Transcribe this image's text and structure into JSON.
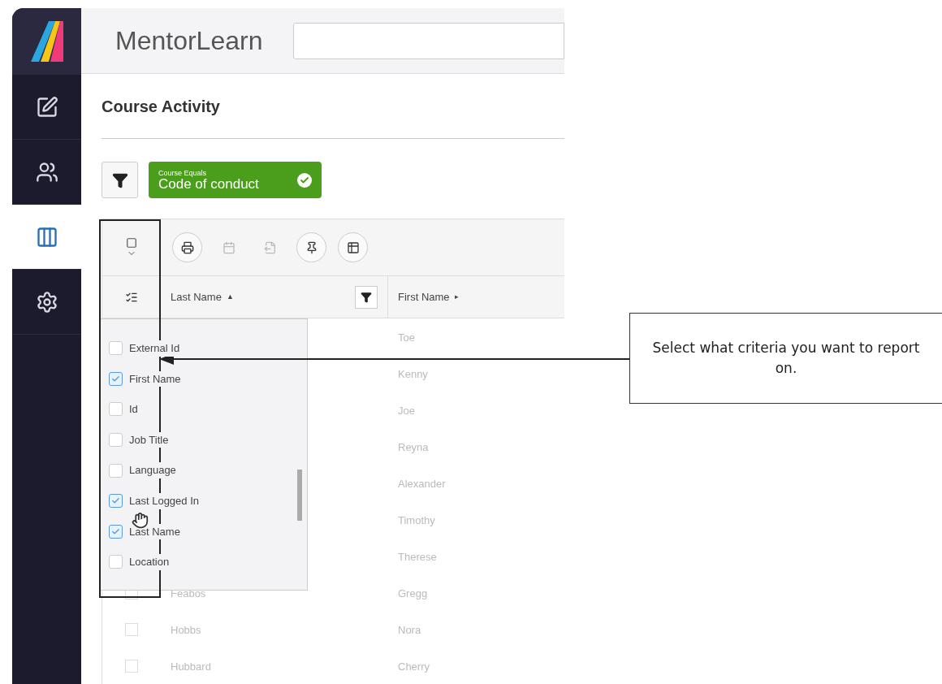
{
  "sidebar": {
    "items": [
      {
        "kind": "edit",
        "selected": false
      },
      {
        "kind": "people",
        "selected": false
      },
      {
        "kind": "table",
        "selected": true
      },
      {
        "kind": "settings",
        "selected": false
      }
    ]
  },
  "header": {
    "app_name": "MentorLearn"
  },
  "page": {
    "title": "Course Activity"
  },
  "filter": {
    "label": "Course Equals",
    "value": "Code of conduct",
    "applied": true
  },
  "toolbar": {
    "tools": [
      {
        "kind": "print",
        "disabled": false
      },
      {
        "kind": "calendar",
        "disabled": true
      },
      {
        "kind": "export",
        "disabled": true
      },
      {
        "kind": "pin",
        "disabled": false
      },
      {
        "kind": "columns",
        "disabled": false
      }
    ]
  },
  "table": {
    "columns": [
      {
        "label": "Last Name",
        "sort_icon": "▲",
        "filter": true
      },
      {
        "label": "First Name",
        "sort_icon": "▸"
      }
    ],
    "rows": [
      {
        "first_name": "Toe"
      },
      {
        "first_name": "Kenny"
      },
      {
        "first_name": "Joe"
      },
      {
        "first_name": "Reyna"
      },
      {
        "first_name": "Alexander"
      },
      {
        "first_name": "Timothy"
      },
      {
        "first_name": "Therese"
      },
      {
        "last_name": "Feabos",
        "first_name": "Gregg",
        "checked": false
      },
      {
        "last_name": "Hobbs",
        "first_name": "Nora",
        "checked": false
      },
      {
        "last_name": "Hubbard",
        "first_name": "Cherry",
        "checked": false
      }
    ]
  },
  "column_picker": {
    "items": [
      {
        "label": "External Id",
        "checked": false
      },
      {
        "label": "First Name",
        "checked": true
      },
      {
        "label": "Id",
        "checked": false
      },
      {
        "label": "Job Title",
        "checked": false
      },
      {
        "label": "Language",
        "checked": false
      },
      {
        "label": "Last Logged In",
        "checked": true
      },
      {
        "label": "Last Name",
        "checked": true
      },
      {
        "label": "Location",
        "checked": false
      }
    ]
  },
  "callout": {
    "text": "Select what criteria you want to report on."
  }
}
